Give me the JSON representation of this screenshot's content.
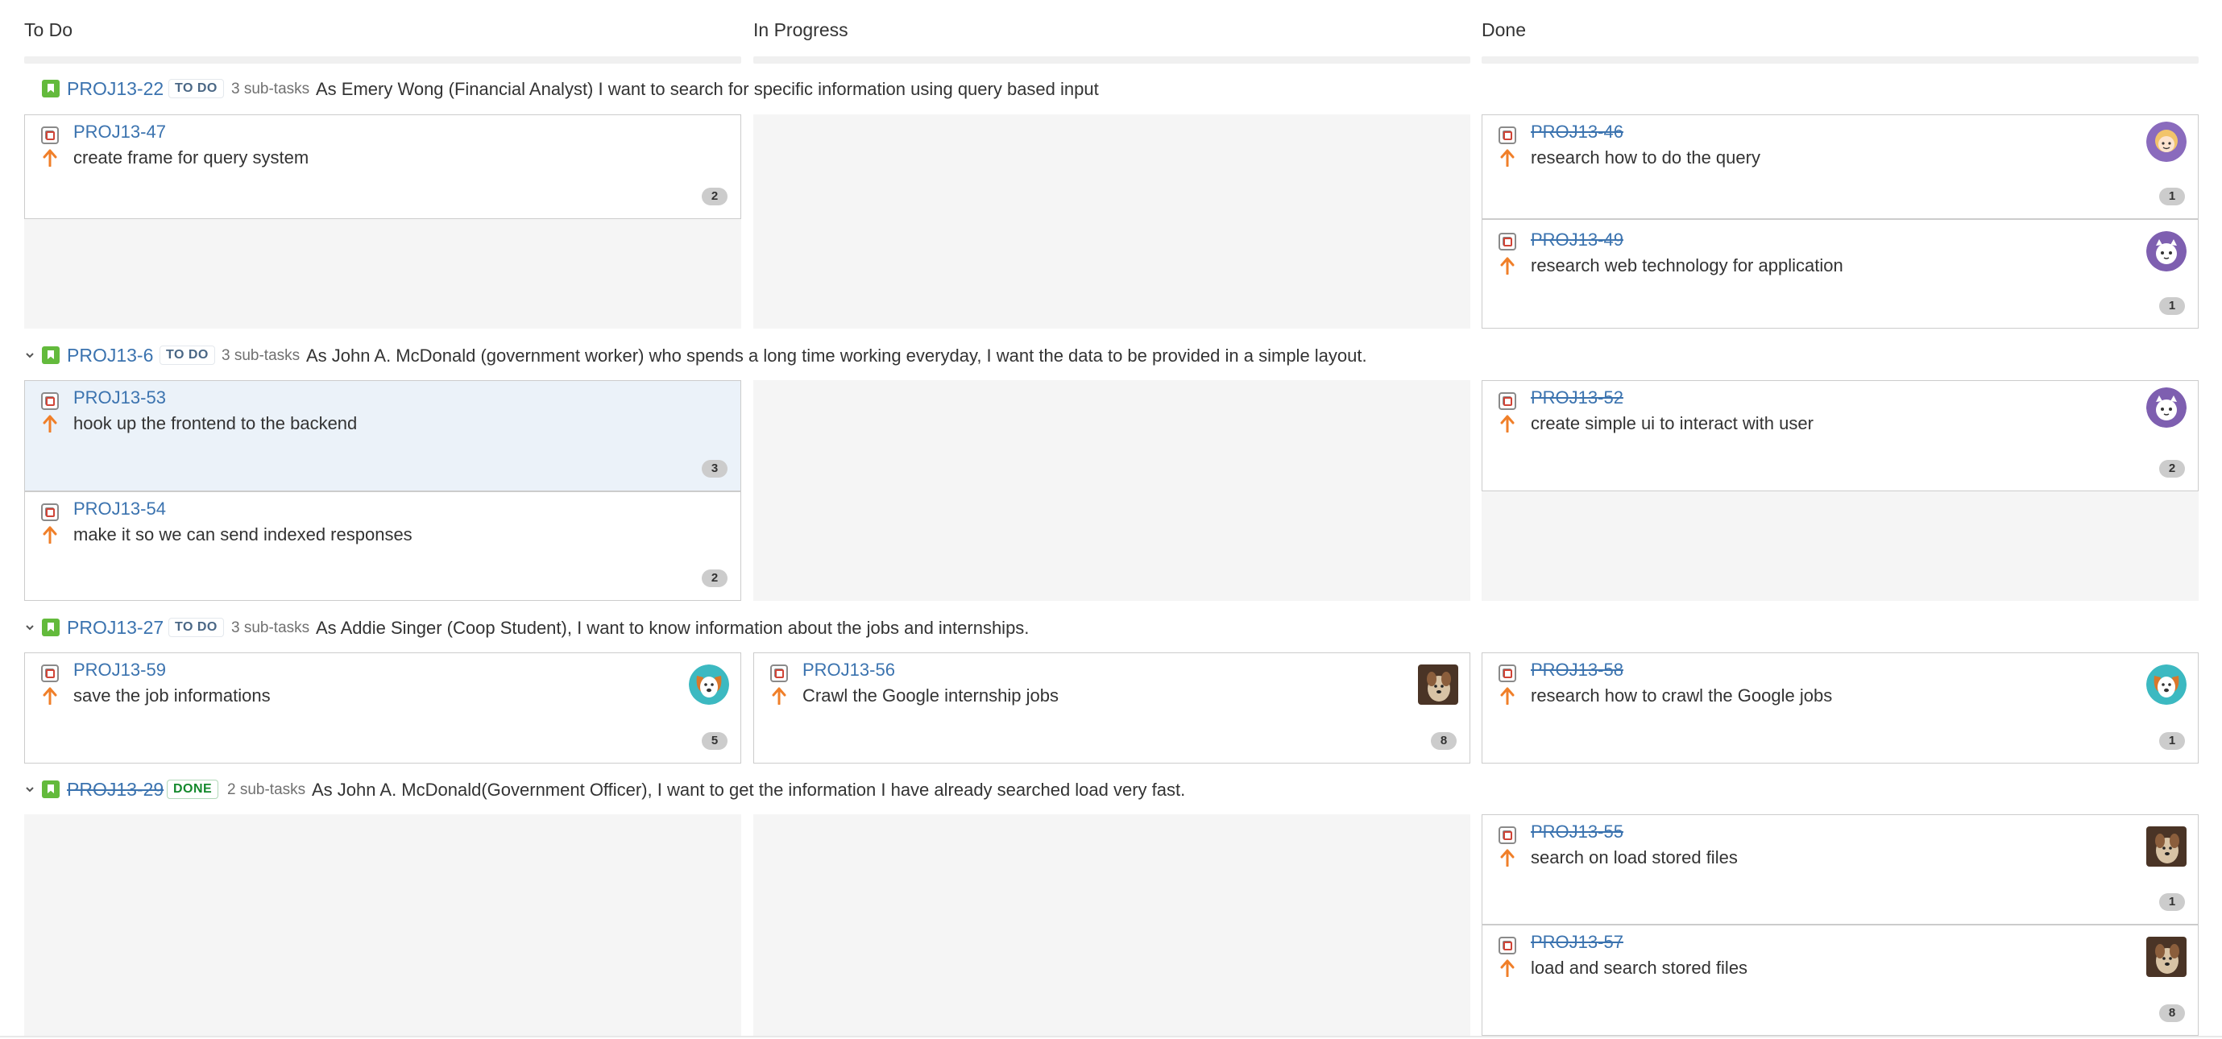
{
  "columns": [
    {
      "title": "To Do"
    },
    {
      "title": "In Progress"
    },
    {
      "title": "Done"
    }
  ],
  "swimlanes": [
    {
      "key": "PROJ13-22",
      "status": "TO DO",
      "subtasks": "3 sub-tasks",
      "summary": "As Emery Wong (Financial Analyst) I want to search for specific information using query based input",
      "cards": [
        {
          "key": "PROJ13-47",
          "summary": "create frame for query system",
          "count": "2",
          "column": "To Do"
        },
        {
          "key": "PROJ13-46",
          "summary": "research how to do the query",
          "count": "1",
          "column": "Done",
          "avatar": "blonde-person-avatar"
        },
        {
          "key": "PROJ13-49",
          "summary": "research web technology for application",
          "count": "1",
          "column": "Done",
          "avatar": "purple-cat-avatar"
        }
      ]
    },
    {
      "key": "PROJ13-6",
      "status": "TO DO",
      "subtasks": "3 sub-tasks",
      "summary": "As John A. McDonald (government worker) who spends a long time working everyday, I want the data to be provided in a simple layout.",
      "cards": [
        {
          "key": "PROJ13-53",
          "summary": "hook up the frontend to the backend",
          "count": "3",
          "column": "To Do"
        },
        {
          "key": "PROJ13-54",
          "summary": "make it so we can send indexed responses",
          "count": "2",
          "column": "To Do"
        },
        {
          "key": "PROJ13-52",
          "summary": "create simple ui to interact with user",
          "count": "2",
          "column": "Done",
          "avatar": "purple-cat-avatar"
        }
      ]
    },
    {
      "key": "PROJ13-27",
      "status": "TO DO",
      "subtasks": "3 sub-tasks",
      "summary": "As Addie Singer (Coop Student), I want to know information about the jobs and internships.",
      "cards": [
        {
          "key": "PROJ13-59",
          "summary": "save the job informations",
          "count": "5",
          "column": "To Do",
          "avatar": "dog-avatar"
        },
        {
          "key": "PROJ13-56",
          "summary": "Crawl the Google internship jobs",
          "count": "8",
          "column": "In Progress",
          "avatar": "photo-avatar"
        },
        {
          "key": "PROJ13-58",
          "summary": "research how to crawl the Google jobs",
          "count": "1",
          "column": "Done",
          "avatar": "dog-avatar"
        }
      ]
    },
    {
      "key": "PROJ13-29",
      "status": "DONE",
      "subtasks": "2 sub-tasks",
      "summary": "As John A. McDonald(Government Officer), I want to get the information I have already searched load very fast.",
      "cards": [
        {
          "key": "PROJ13-55",
          "summary": "search on load stored files",
          "count": "1",
          "column": "Done",
          "avatar": "photo-avatar"
        },
        {
          "key": "PROJ13-57",
          "summary": "load and search stored files",
          "count": "8",
          "column": "Done",
          "avatar": "photo-avatar"
        }
      ]
    }
  ],
  "colors": {
    "link": "#3b73af",
    "story": "#63ba3c",
    "priority_high": "#f07f29",
    "done_lozenge": "#14892c",
    "todo_lozenge": "#4a6785",
    "selected_card": "#ebf2f9"
  }
}
